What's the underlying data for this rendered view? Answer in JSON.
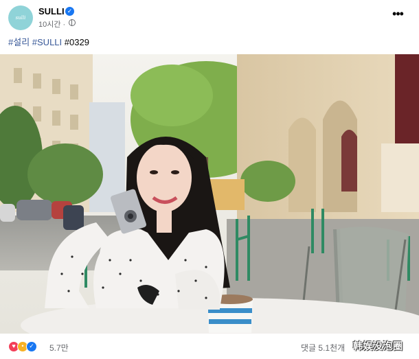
{
  "post": {
    "author": "SULLI",
    "avatar_text": "sulli",
    "time": "10시간 ·",
    "privacy_icon": "globe-icon",
    "more_icon": "more-horizontal-icon",
    "verified_icon": "verified-badge-icon",
    "verified_glyph": "✓",
    "more_glyph": "•••"
  },
  "caption": {
    "tags": [
      "#설리",
      "#SULLI",
      "#0329"
    ]
  },
  "photo": {
    "description_icon": "photo"
  },
  "footer": {
    "reaction_icons": [
      "love-icon",
      "angry-icon",
      "like-icon"
    ],
    "reaction_count": "5.7만",
    "comment_count": "댓글 5.1천개",
    "watermark": "韩娱没泡圈"
  },
  "colors": {
    "link": "#385898",
    "meta": "#65676b",
    "verified": "#1877f2"
  }
}
